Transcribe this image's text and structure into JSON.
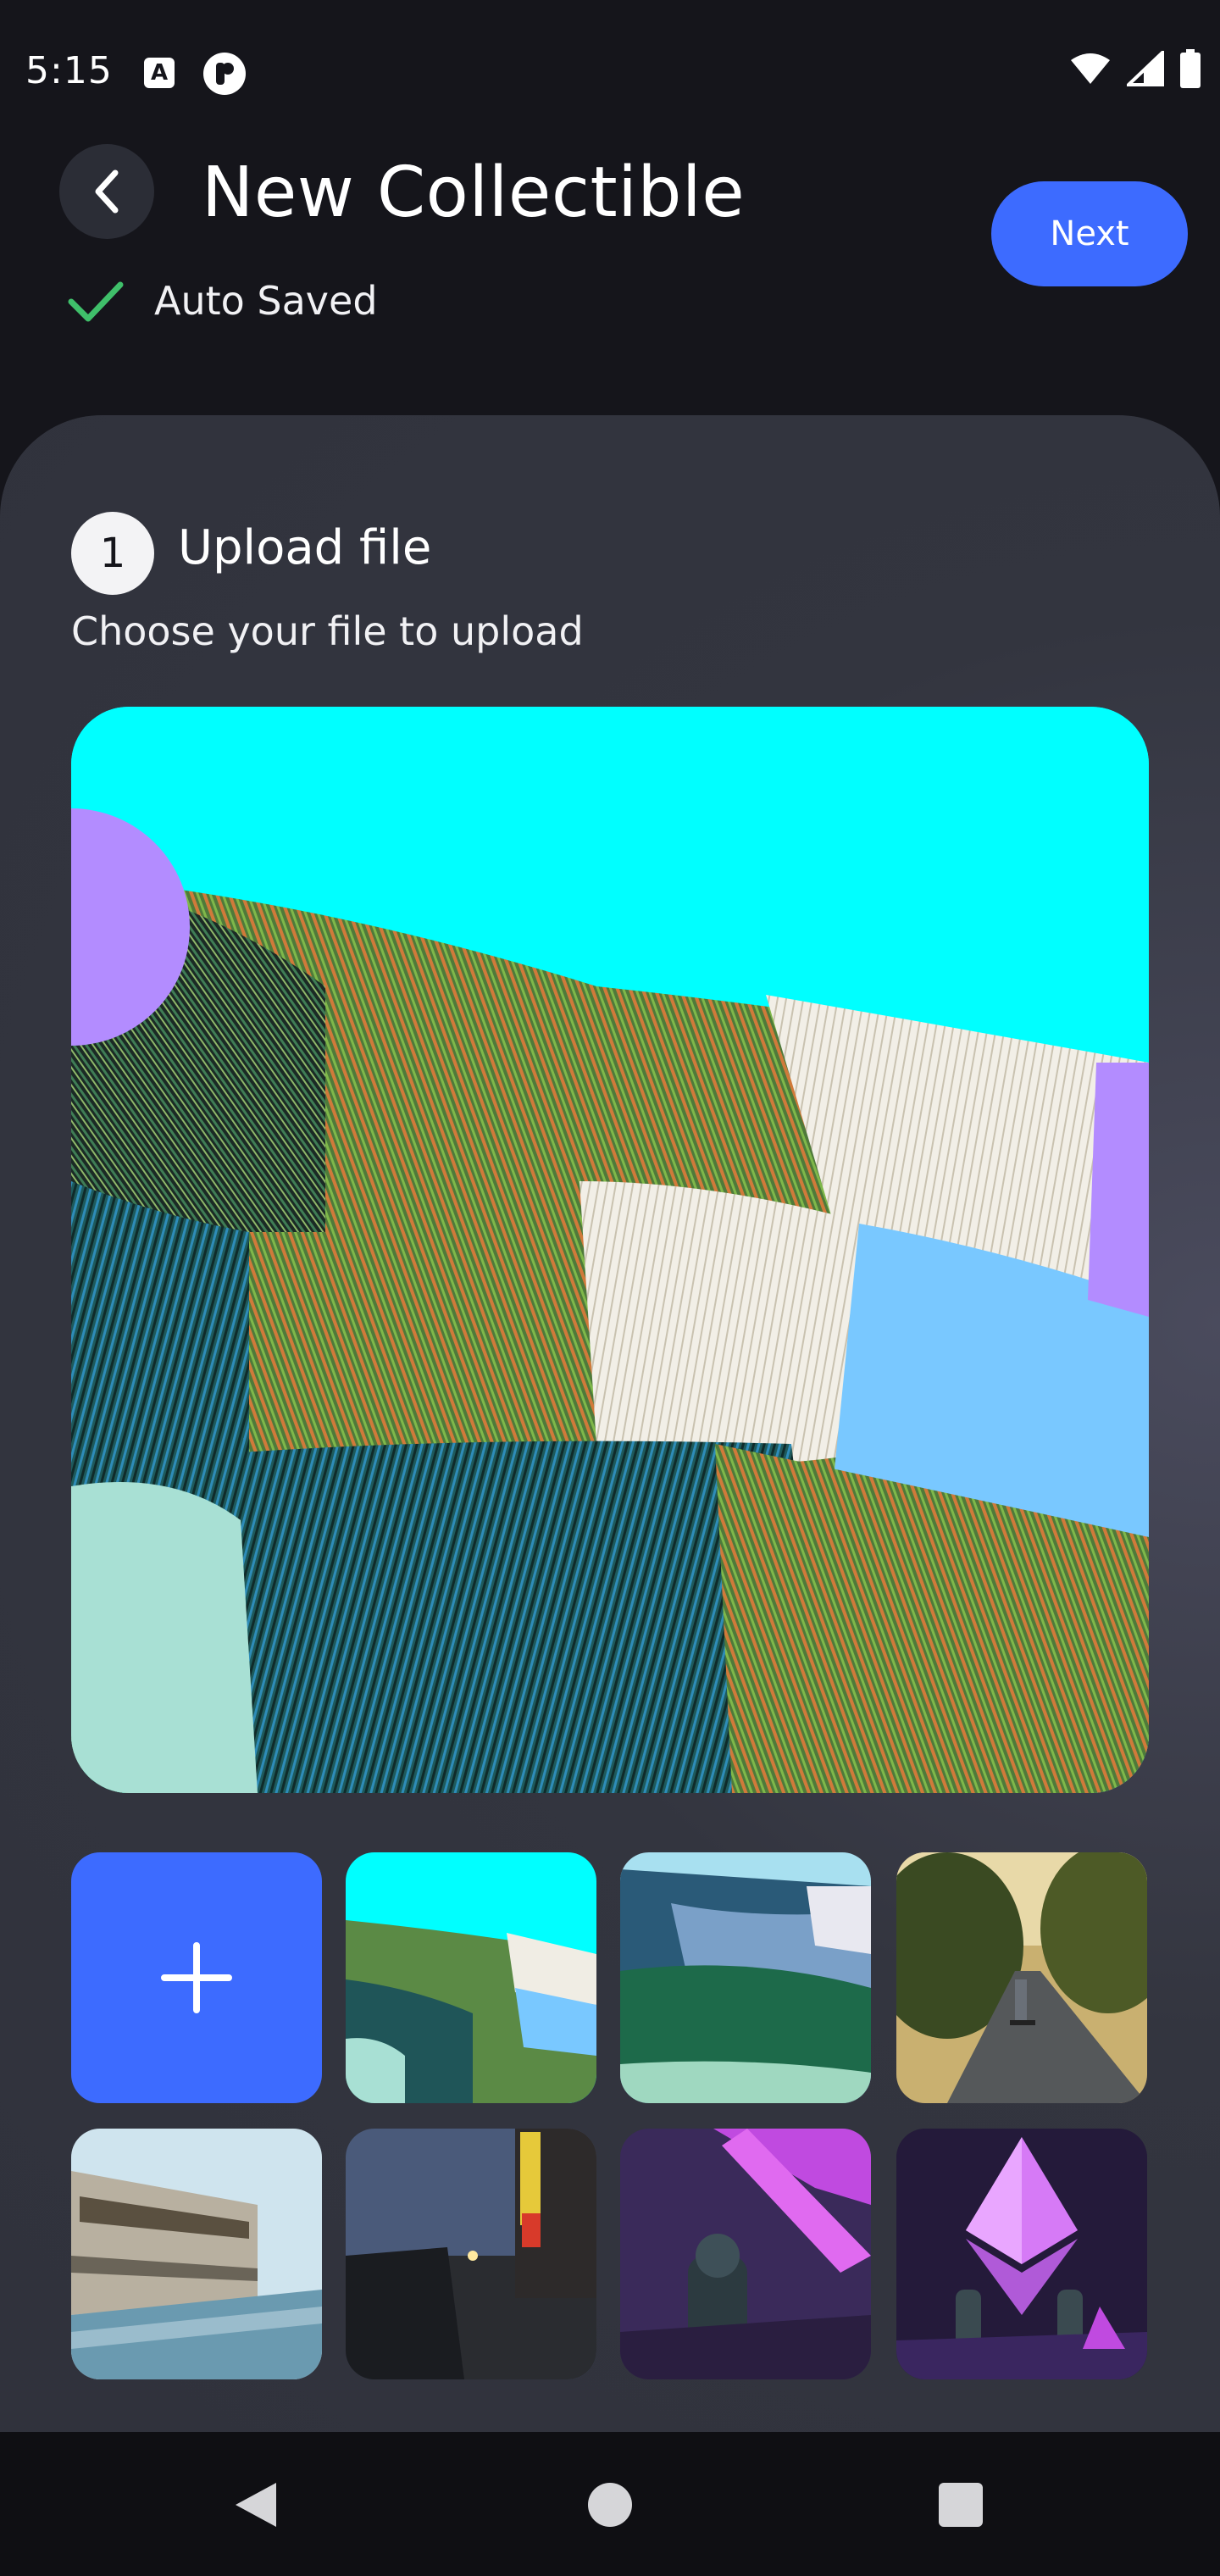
{
  "status_bar": {
    "time": "5:15",
    "icons": [
      "keyboard-a-icon",
      "p-app-icon",
      "wifi-icon",
      "signal-icon",
      "battery-icon"
    ]
  },
  "header": {
    "title": "New Collectible",
    "back_icon": "chevron-left-icon",
    "next_label": "Next",
    "autosave_label": "Auto Saved"
  },
  "step": {
    "number": "1",
    "title": "Upload file",
    "subtitle": "Choose your file to upload"
  },
  "gallery": {
    "add_icon": "plus-icon",
    "thumbnails": [
      "abstract-cyan-swirl",
      "abstract-blue-green-swirl",
      "skateboarder-on-road",
      "passenger-train",
      "city-street-at-dusk",
      "purple-crystal-astronaut",
      "ethereum-crystal-scene"
    ]
  },
  "colors": {
    "accent": "#3d6bff",
    "background": "#15151b",
    "card": "#33353f",
    "check": "#3fbf6a"
  },
  "nav_bar": {
    "icons": [
      "nav-back-icon",
      "nav-home-icon",
      "nav-recents-icon"
    ]
  }
}
